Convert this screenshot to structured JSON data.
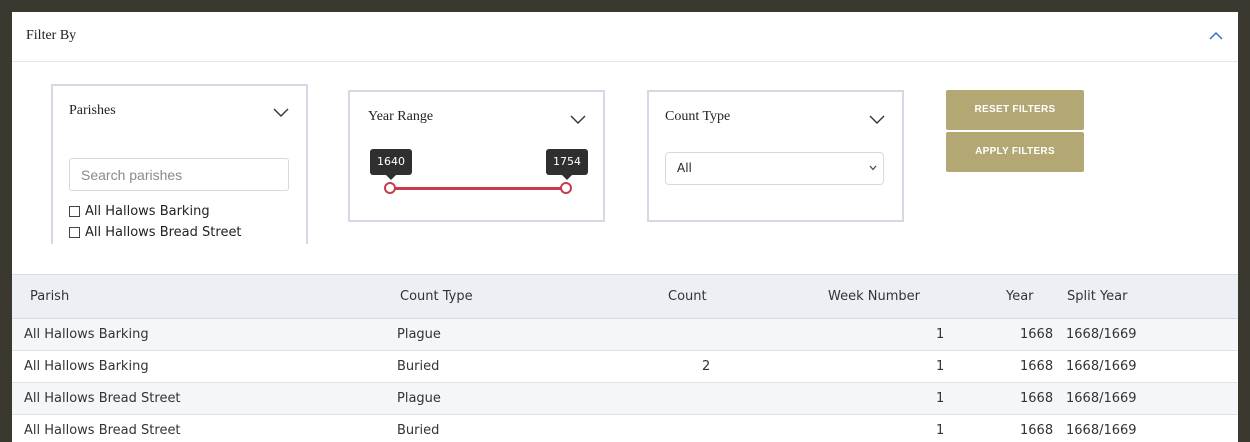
{
  "filter": {
    "title": "Filter By",
    "parishes": {
      "label": "Parishes",
      "search_placeholder": "Search parishes",
      "options": [
        "All Hallows Barking",
        "All Hallows Bread Street"
      ]
    },
    "year_range": {
      "label": "Year Range",
      "min_label": "1640",
      "max_label": "1754",
      "min_value": 1640,
      "max_value": 1754
    },
    "count_type": {
      "label": "Count Type",
      "selected": "All"
    },
    "buttons": {
      "reset": "RESET FILTERS",
      "apply": "APPLY FILTERS"
    }
  },
  "table": {
    "columns": [
      "Parish",
      "Count Type",
      "Count",
      "Week Number",
      "Year",
      "Split Year"
    ],
    "rows": [
      [
        "All Hallows Barking",
        "Plague",
        "",
        "1",
        "1668",
        "1668/1669"
      ],
      [
        "All Hallows Barking",
        "Buried",
        "2",
        "1",
        "1668",
        "1668/1669"
      ],
      [
        "All Hallows Bread Street",
        "Plague",
        "",
        "1",
        "1668",
        "1668/1669"
      ],
      [
        "All Hallows Bread Street",
        "Buried",
        "",
        "1",
        "1668",
        "1668/1669"
      ]
    ]
  },
  "colors": {
    "accent_button": "#b3a874",
    "slider": "#c83a4c",
    "collapse_icon": "#2f6fd1"
  }
}
